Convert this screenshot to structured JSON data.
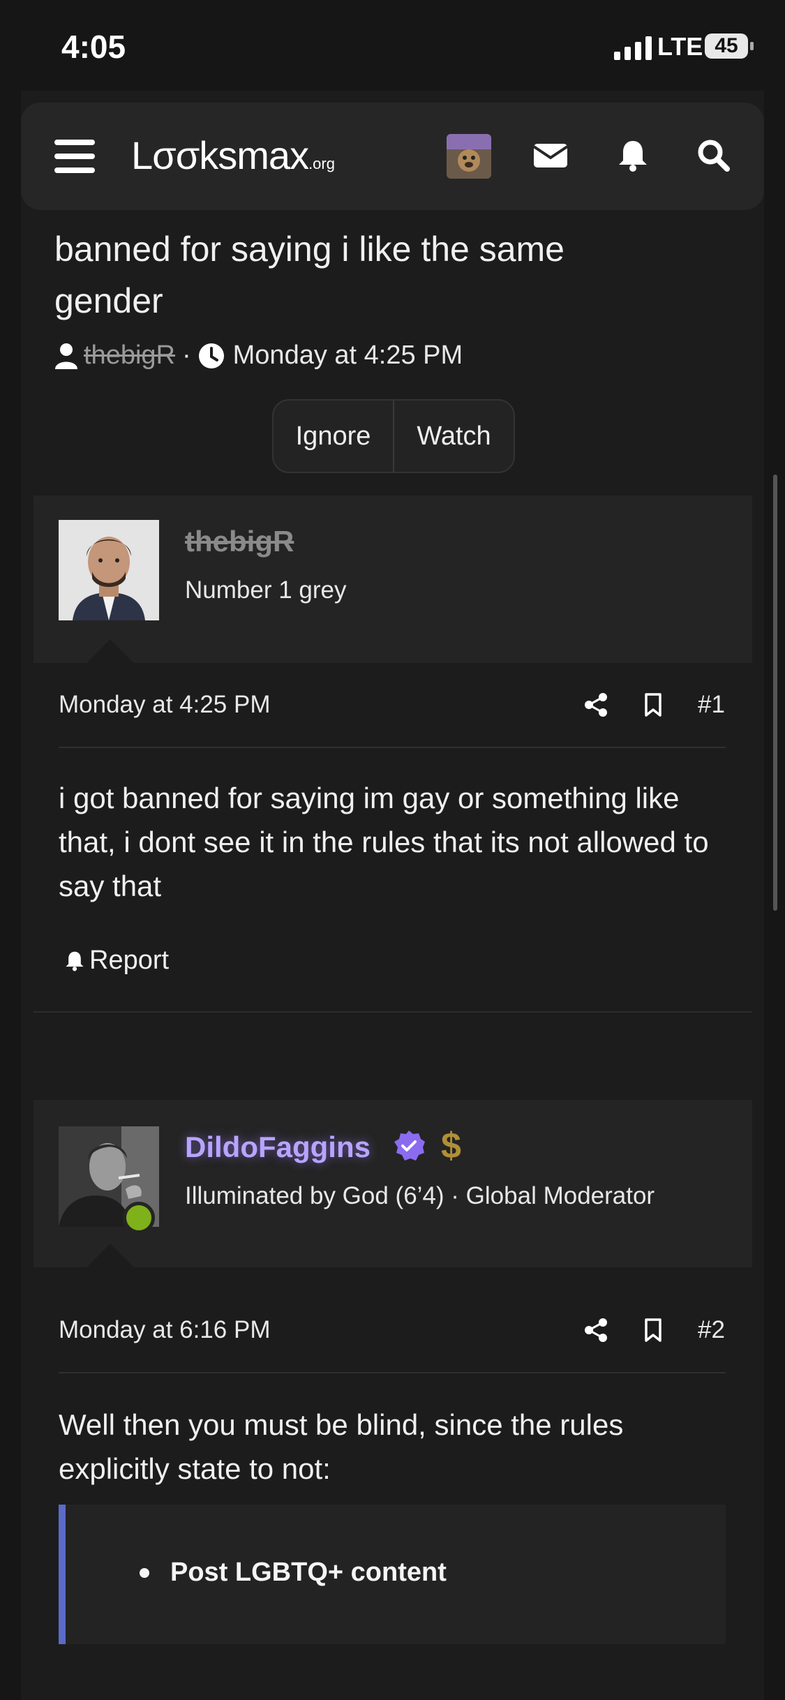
{
  "status_bar": {
    "time": "4:05",
    "network": "LTE",
    "battery": "45"
  },
  "header": {
    "logo_main": "Lσσksmax",
    "logo_suffix": ".org",
    "icons": [
      "menu-icon",
      "avatar",
      "mail-icon",
      "bell-icon",
      "search-icon"
    ]
  },
  "thread": {
    "title": "banned for saying i like the same gender",
    "author": "thebigR",
    "date": "Monday at 4:25 PM",
    "buttons": {
      "ignore": "Ignore",
      "watch": "Watch"
    }
  },
  "posts": [
    {
      "username": "thebigR",
      "role": "Number 1 grey",
      "date": "Monday at 4:25 PM",
      "number": "#1",
      "body": "i got banned for saying im gay or something like that, i dont see it in the rules that its not allowed to say that",
      "report_label": "Report"
    },
    {
      "username": "DildoFaggins",
      "role": "Illuminated by God (6’4) · Global Moderator",
      "date": "Monday at 6:16 PM",
      "number": "#2",
      "body": "Well then you must be blind, since the rules explicitly state to not:",
      "quote_item": "Post LGBTQ+ content"
    }
  ],
  "colors": {
    "background": "#161616",
    "moderator_name": "#b8a4ff",
    "verified_badge": "#8b6cf0",
    "online_dot": "#7fb11a",
    "quote_bar": "#5a6bc8"
  }
}
